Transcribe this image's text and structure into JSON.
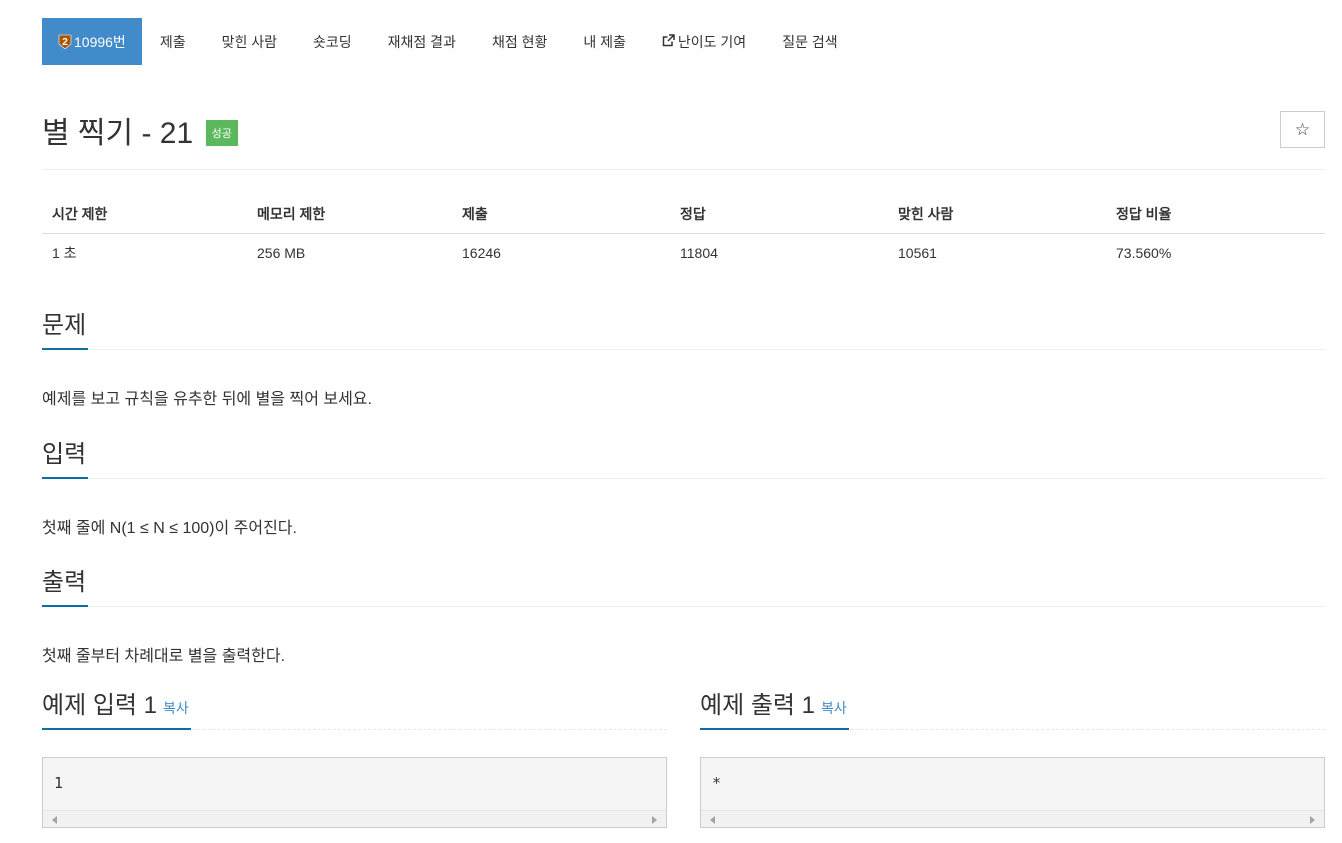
{
  "nav": {
    "items": [
      {
        "label": "10996번",
        "active": true,
        "tier_icon": "silver-tier-icon",
        "tier_level": "2"
      },
      {
        "label": "제출"
      },
      {
        "label": "맞힌 사람"
      },
      {
        "label": "숏코딩"
      },
      {
        "label": "재채점 결과"
      },
      {
        "label": "채점 현황"
      },
      {
        "label": "내 제출"
      },
      {
        "label": "난이도 기여",
        "icon": "external-link-icon"
      },
      {
        "label": "질문 검색"
      }
    ]
  },
  "problem": {
    "title": "별 찍기 - 21",
    "status_badge": "성공",
    "star_icon": "☆"
  },
  "info_table": {
    "headers": [
      "시간 제한",
      "메모리 제한",
      "제출",
      "정답",
      "맞힌 사람",
      "정답 비율"
    ],
    "values": [
      "1 초",
      "256 MB",
      "16246",
      "11804",
      "10561",
      "73.560%"
    ]
  },
  "sections": {
    "problem": {
      "heading": "문제",
      "text": "예제를 보고 규칙을 유추한 뒤에 별을 찍어 보세요."
    },
    "input": {
      "heading": "입력",
      "text": "첫째 줄에 N(1 ≤ N ≤ 100)이 주어진다."
    },
    "output": {
      "heading": "출력",
      "text": "첫째 줄부터 차례대로 별을 출력한다."
    }
  },
  "samples": {
    "input": {
      "heading": "예제 입력 1",
      "copy_label": "복사",
      "content": "1"
    },
    "output": {
      "heading": "예제 출력 1",
      "copy_label": "복사",
      "content": "*"
    }
  },
  "colors": {
    "active_tab": "#428bca",
    "success_badge": "#5cb85c",
    "section_underline": "#0b6fa1",
    "link": "#428bca"
  }
}
